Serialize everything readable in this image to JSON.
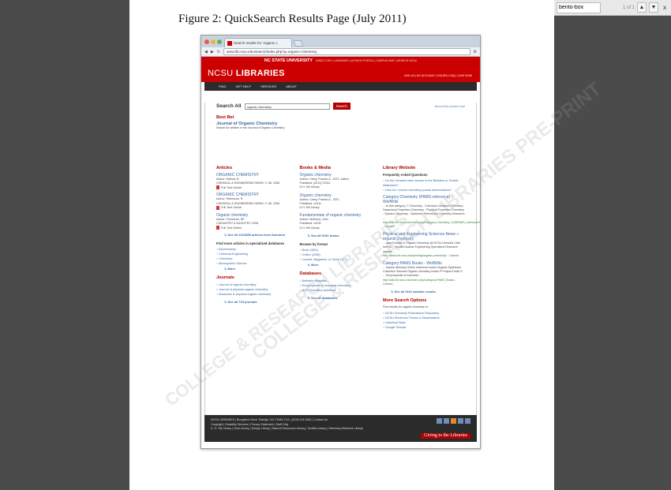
{
  "viewer": {
    "find_value": "bento-box",
    "find_count": "1 of 1",
    "prev_label": "▲",
    "next_label": "▼",
    "close_label": "x"
  },
  "document": {
    "caption": "Figure 2: QuickSearch Results Page (July 2011)",
    "watermark_1": "COLLEGE & RESEARCH LIBRARIES PRE-PRINT",
    "watermark_2": "COLLEGE & RESEARCH LIBRARIES"
  },
  "browser": {
    "tab_title": "Search results for 'organic c",
    "url": "www.lib.ncsu.edu/search/index.php?q=organic+chemistry"
  },
  "site": {
    "brand": "NC STATE UNIVERSITY",
    "top_links": "DIRECTORY | LIBRARIES | MYPACK PORTAL | CAMPUS MAP | SEARCH NCSU",
    "logo_light": "NCSU ",
    "logo_bold": "LIBRARIES",
    "util_links": "ASK US | MY ACCOUNT | HOURS | FAQ | CHAT NOW",
    "nav": [
      "FIND",
      "GET HELP",
      "SERVICES",
      "ABOUT"
    ]
  },
  "search": {
    "label": "Search All",
    "query": "organic chemistry",
    "button": "Search",
    "about": "About this search tool"
  },
  "bestbet": {
    "heading": "Best Bet",
    "title": "Journal of Organic Chemistry",
    "desc": "Search for articles in the Journal of Organic Chemistry"
  },
  "articles": {
    "heading": "Articles",
    "items": [
      {
        "title": "ORGANIC CHEMISTRY",
        "author": "Author: Halford, B",
        "source": "CHEMICAL & ENGINEERING NEWS, V. 86, 2008",
        "link": "Full Text Online"
      },
      {
        "title": "ORGANIC CHEMISTRY",
        "author": "Author: Rebescoe, R",
        "source": "CHEMICAL & ENGINEERING NEWS, V. 86, 2008",
        "link": "Full Text Online"
      },
      {
        "title": "Organic chemistry",
        "author": "Author: Freestone, NP",
        "source": "CHEMISTRY & INDUSTRY, 2008",
        "link": "Full Text Online"
      }
    ],
    "see_all": "See all 1021859 articles from Summon",
    "more_heading": "Find more articles in specialized databases",
    "dbs": [
      "Biochemistry",
      "Chemical Engineering",
      "Chemistry",
      "Atmospheric Science"
    ],
    "more": "More"
  },
  "journals": {
    "heading": "Journals",
    "items": [
      "Journal of organic chemistry",
      "Journal of physical organic chemistry",
      "Advances in physical organic chemistry"
    ],
    "see_all": "See all 733 journals"
  },
  "books": {
    "heading": "Books & Media",
    "items": [
      {
        "title": "Organic chemistry",
        "author": "Author: Carey, Francis A., 1937- author.",
        "pub": "Published: [2011] ©2011.",
        "loc": "D.H. Hill Library"
      },
      {
        "title": "Organic chemistry",
        "author": "Author: Carey, Francis A., 1937-",
        "pub": "Published: c2011.",
        "loc": "D.H. Hill Library"
      },
      {
        "title": "Fundamentals of organic chemistry",
        "author": "Author: McMurry, John.",
        "pub": "Published: c2011.",
        "loc": "D.H. Hill Library"
      }
    ],
    "see_all": "See all 5191 books",
    "browse_heading": "Browse by format",
    "formats": [
      "Book (4811)",
      "Online (1289)",
      "Journal, Magazine, or Serial (177)"
    ],
    "more": "More"
  },
  "databases": {
    "heading": "Databases",
    "items": [
      "Beilstein database",
      "Encyclopedia of analytical chemistry",
      "NIST chemistry webbook"
    ],
    "see_all": "See all databases"
  },
  "website": {
    "heading": "Library Website",
    "faq_heading": "Frequently Asked Questions",
    "faqs": [
      "Do the Libraries have access to the Beilstein or Gmelin databases?",
      "How do I resolve chemistry journal abbreviations?"
    ],
    "r1_title": "Category:Chemistry (PAMS reference) - WolfWiki",
    "r1_text": "... to this category. C Chemistry - Chemical Literature Chemistry - Hazardous Properties Chemistry - Physical Properties Chemistry - Spectra Chemistry - Synthesis References Chemistry Research ...",
    "r1_url": "http://wiki.lib.ncsu.edu/index.php/Category:Chemistry_%28PAMS_reference%29 - Cached",
    "r2_title": "Physical and Engineering Sciences News » organic chemistry",
    "r2_text": "... New Ebooks in Organic Chemistry @ NCSU Libraries Click here to ... Books Nuclear Engineering Operations Research organic ...",
    "r2_url": "http://news.lib.ncsu.edu/pes/tag/organic-chemistry/ - Cached",
    "r3_title": "Category:PAMS Books - WolfWiki",
    "r3_text": "... buyers directory Online reference books Organic Syntheses Collective Volumes Organic chemistry books P Project Euclid S ... Encyclopedia of industrial ...",
    "r3_url": "http://wiki.lib.ncsu.edu/index.php/Category:PAMS_Books - Cached",
    "see_all": "See all 1161 website results",
    "more_heading": "More Search Options",
    "more_text": "Find results for organic chemistry in:",
    "options": [
      "NCSU Scholarly Publications Repository",
      "NCSU Electronic Theses & Dissertations",
      "Historical State",
      "Google Scholar"
    ]
  },
  "footer": {
    "line1": "NCSU LIBRARIES | Broughton Drive, Raleigh, NC 27695-7111 | (919) 515-3364 | Contact Us",
    "line2": "Copyright | Disability Services | Privacy Statement | Staff Only",
    "line3": "D. H. Hill Library | Hunt Library | Design Library | Natural Resources Library | Textiles Library | Veterinary Medicine Library",
    "give": "Giving to the Libraries"
  },
  "colors": {
    "accent": "#cc0000",
    "link": "#3667a6"
  }
}
